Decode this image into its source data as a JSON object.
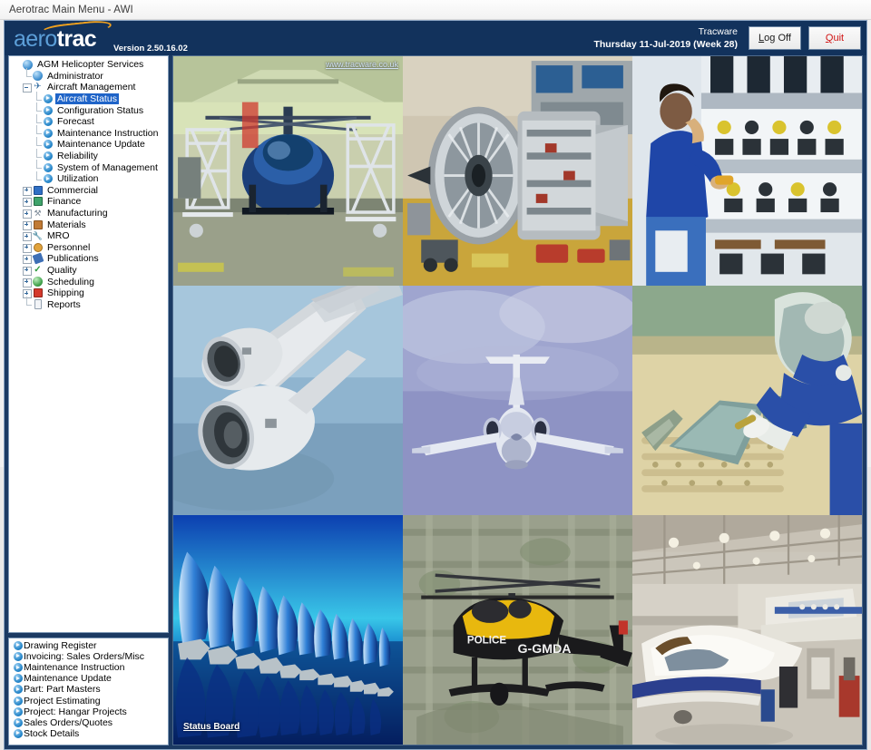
{
  "window": {
    "title": "Aerotrac Main Menu - AWI"
  },
  "header": {
    "logo_primary": "aero",
    "logo_secondary": "trac",
    "version": "Version 2.50.16.02",
    "company": "Tracware",
    "date": "Thursday 11-Jul-2019 (Week 28)",
    "logoff_label": "Log Off",
    "quit_label": "Quit",
    "accent_orange": "#f0a11e",
    "accent_blue": "#5c9fd8",
    "header_bg": "#12325c",
    "quit_color": "#d11414"
  },
  "sidebar": {
    "tree": [
      {
        "label": "AGM Helicopter Services",
        "level": 0,
        "icon": "globe-icon",
        "twisty": "none",
        "selected": false
      },
      {
        "label": "Administrator",
        "level": 1,
        "icon": "globe-icon",
        "twisty": "elbow",
        "selected": false
      },
      {
        "label": "Aircraft Management",
        "level": 1,
        "icon": "plane-icon",
        "twisty": "minus",
        "selected": false
      },
      {
        "label": "Aircraft Status",
        "level": 2,
        "icon": "play-icon",
        "twisty": "elbow",
        "selected": true
      },
      {
        "label": "Configuration Status",
        "level": 2,
        "icon": "play-icon",
        "twisty": "elbow",
        "selected": false
      },
      {
        "label": "Forecast",
        "level": 2,
        "icon": "play-icon",
        "twisty": "elbow",
        "selected": false
      },
      {
        "label": "Maintenance Instruction",
        "level": 2,
        "icon": "play-icon",
        "twisty": "elbow",
        "selected": false
      },
      {
        "label": "Maintenance Update",
        "level": 2,
        "icon": "play-icon",
        "twisty": "elbow",
        "selected": false
      },
      {
        "label": "Reliability",
        "level": 2,
        "icon": "play-icon",
        "twisty": "elbow",
        "selected": false
      },
      {
        "label": "System of Management",
        "level": 2,
        "icon": "play-icon",
        "twisty": "elbow",
        "selected": false
      },
      {
        "label": "Utilization",
        "level": 2,
        "icon": "play-icon",
        "twisty": "elbow",
        "selected": false
      },
      {
        "label": "Commercial",
        "level": 1,
        "icon": "book-icon",
        "twisty": "plus",
        "selected": false
      },
      {
        "label": "Finance",
        "level": 1,
        "icon": "money-icon",
        "twisty": "plus",
        "selected": false
      },
      {
        "label": "Manufacturing",
        "level": 1,
        "icon": "tools-icon",
        "twisty": "plus",
        "selected": false
      },
      {
        "label": "Materials",
        "level": 1,
        "icon": "bench-icon",
        "twisty": "plus",
        "selected": false
      },
      {
        "label": "MRO",
        "level": 1,
        "icon": "wrench-icon",
        "twisty": "plus",
        "selected": false
      },
      {
        "label": "Personnel",
        "level": 1,
        "icon": "people-icon",
        "twisty": "plus",
        "selected": false
      },
      {
        "label": "Publications",
        "level": 1,
        "icon": "books-icon",
        "twisty": "plus",
        "selected": false
      },
      {
        "label": "Quality",
        "level": 1,
        "icon": "check-icon",
        "twisty": "plus",
        "selected": false
      },
      {
        "label": "Scheduling",
        "level": 1,
        "icon": "calendar-icon",
        "twisty": "plus",
        "selected": false
      },
      {
        "label": "Shipping",
        "level": 1,
        "icon": "truck-icon",
        "twisty": "plus",
        "selected": false
      },
      {
        "label": "Reports",
        "level": 1,
        "icon": "page-icon",
        "twisty": "elbow",
        "selected": false
      }
    ],
    "shortcuts": [
      {
        "label": "Drawing Register"
      },
      {
        "label": "Invoicing: Sales Orders/Misc"
      },
      {
        "label": "Maintenance Instruction"
      },
      {
        "label": "Maintenance Update"
      },
      {
        "label": "Part: Part Masters"
      },
      {
        "label": "Project Estimating"
      },
      {
        "label": "Project: Hangar Projects"
      },
      {
        "label": "Sales Orders/Quotes"
      },
      {
        "label": "Stock Details"
      }
    ]
  },
  "gallery": {
    "watermark": "www.tracware.co.uk",
    "status_board_label": "Status Board",
    "cells": [
      {
        "name": "helicopter-in-hangar-photo",
        "alt": "Blue helicopter on maintenance stands in workshop"
      },
      {
        "name": "jet-engine-teardown-photo",
        "alt": "Large turbofan engine module on stand in test bay"
      },
      {
        "name": "technician-inspection-photo",
        "alt": "Technician in blue overalls inspecting tooling rack"
      },
      {
        "name": "wing-engines-inflight-photo",
        "alt": "Two underwing engines of airliner in flight"
      },
      {
        "name": "business-jet-inflight-photo",
        "alt": "Business jet head on against cloudy sky"
      },
      {
        "name": "composite-layup-photo",
        "alt": "Worker bonding composite panel on workbench"
      },
      {
        "name": "compressor-blades-photo",
        "alt": "Row of compressor blades on blue background"
      },
      {
        "name": "police-helicopter-photo",
        "alt": "Yellow and black police helicopter G-GMDA over city"
      },
      {
        "name": "hangar-jets-photo",
        "alt": "Business jets inside maintenance hangar"
      }
    ]
  }
}
